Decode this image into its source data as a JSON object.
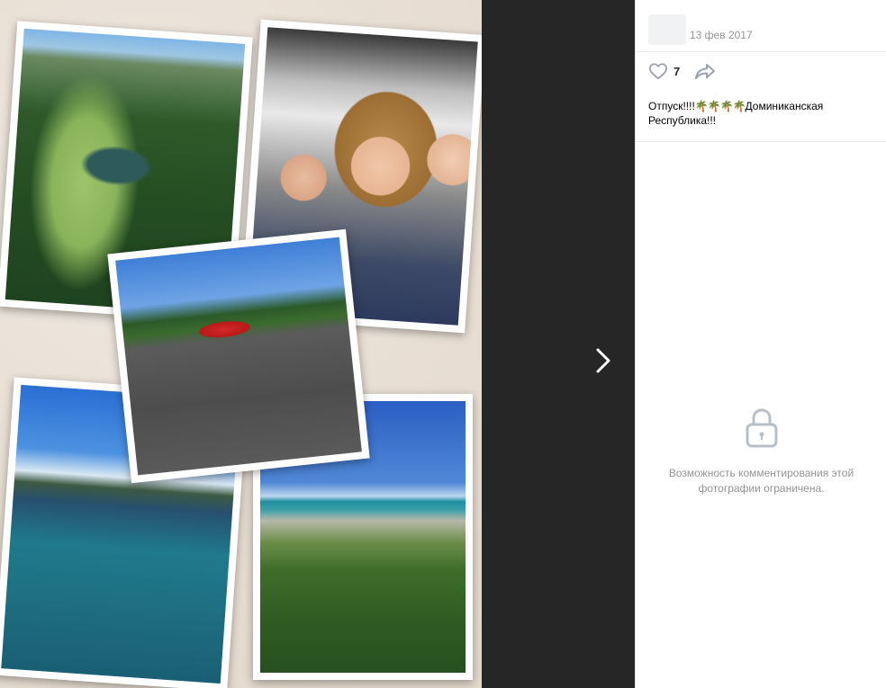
{
  "post": {
    "date": "13 фев 2017",
    "likes": "7",
    "caption_prefix": "Отпуск!!!!",
    "caption_emoji": "🌴🌴🌴🌴",
    "caption_suffix": "Доминиканская Республика!!!"
  },
  "comments": {
    "restricted_text": "Возможность комментирования этой фотографии ограничена."
  },
  "icons": {
    "like": "heart-icon",
    "share": "share-icon",
    "next": "chevron-right-icon",
    "lock": "lock-icon"
  },
  "colors": {
    "panel_bg": "#ffffff",
    "viewer_bg": "#262626",
    "muted_text": "#939393",
    "icon_gray": "#99a2ad"
  }
}
